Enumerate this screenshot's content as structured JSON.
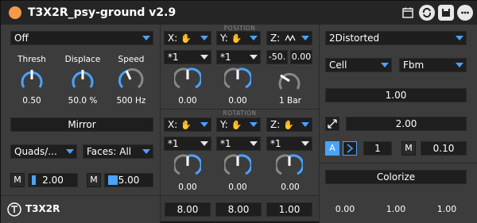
{
  "title": "T3X2R_psy-ground v2.9",
  "brand": "T3X2R",
  "colors": {
    "accent": "#4aa3ff",
    "power": "#f2994a",
    "panel": "#3c3c3c"
  },
  "left": {
    "mode": "Off",
    "knobs": [
      {
        "label": "Thresh",
        "value": "0.50"
      },
      {
        "label": "Displace",
        "value": "50.0 %"
      },
      {
        "label": "Speed",
        "value": "500 Hz"
      }
    ],
    "mirror": "Mirror",
    "quads": "Quads/...",
    "faces": "Faces: All",
    "m1_label": "M",
    "m1_value": "2.00",
    "m2_label": "M",
    "m2_value": "5.00"
  },
  "position": {
    "section": "POSITION",
    "x_label": "X:",
    "y_label": "Y:",
    "z_label": "Z:",
    "mult1": "*1",
    "mult2": "*1",
    "z_left": "-50.",
    "z_right": "0.00",
    "knob_values": [
      "0.00",
      "0.00",
      "1 Bar"
    ]
  },
  "rotation": {
    "section": "ROTATION",
    "x_label": "X:",
    "y_label": "Y:",
    "z_label": "Z:",
    "mult1": "*1",
    "mult2": "*1",
    "mult3": "*1",
    "knob_values": [
      "0.00",
      "0.00",
      "0.00"
    ]
  },
  "bottom_center": [
    "8.00",
    "8.00",
    "1.00"
  ],
  "right": {
    "distort": "2Distorted",
    "cell": "Cell",
    "fbm": "Fbm",
    "value1": "1.00",
    "value2": "2.00",
    "a_label": "A",
    "step_value": "1",
    "m_label": "M",
    "m_value": "0.10",
    "colorize": "Colorize",
    "rgb": [
      "0.00",
      "1.00",
      "1.00"
    ]
  }
}
